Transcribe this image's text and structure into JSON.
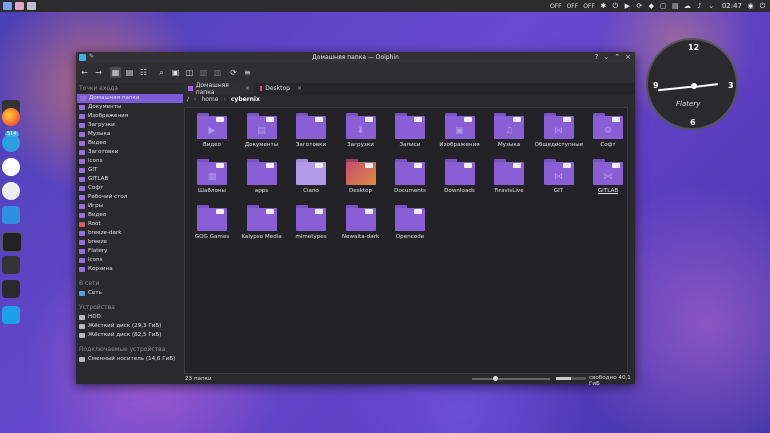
{
  "panel": {
    "off1": "OFF",
    "off2": "OFF",
    "off3": "OFF",
    "time": "02:47"
  },
  "clock": {
    "n12": "12",
    "n3": "3",
    "n6": "6",
    "n9": "9",
    "brand": "Flatery"
  },
  "window": {
    "title": "Домашняя папка — Dolphin",
    "controls": [
      "?",
      "⌄",
      "⌃",
      "×"
    ]
  },
  "sidebar": {
    "places_header": "Точки входа",
    "places": [
      "Домашняя папка",
      "Документы",
      "Изображения",
      "Загрузки",
      "Музыка",
      "Видео",
      "Заготовки",
      "icons",
      "GIT",
      "GITLAB",
      "Софт",
      "Рабочий стол",
      "Игры",
      "Видео",
      "Root",
      "breeze-dark",
      "breeze",
      "Flatery",
      "icons",
      "Корзина"
    ],
    "network_header": "В сети",
    "network": [
      "Сеть"
    ],
    "devices_header": "Устройства",
    "devices": [
      "HDD",
      "Жёсткий диск (29,3 ГиБ)",
      "Жёсткий диск (82,5 ГиБ)"
    ],
    "removable_header": "Подключаемые устройства",
    "removable": [
      "Сменный носитель (14,6 ГиБ)"
    ]
  },
  "tabs": [
    {
      "label": "Домашняя папка"
    },
    {
      "label": "Desktop"
    }
  ],
  "breadcrumb": {
    "root": "/",
    "home": "home",
    "user": "cybernix"
  },
  "folders": [
    {
      "name": "Видео",
      "glyph": "▶"
    },
    {
      "name": "Документы",
      "glyph": "▤"
    },
    {
      "name": "Заготовки",
      "glyph": ""
    },
    {
      "name": "Загрузки",
      "glyph": "⬇"
    },
    {
      "name": "Записи",
      "glyph": ""
    },
    {
      "name": "Изображения",
      "glyph": "▣"
    },
    {
      "name": "Музыка",
      "glyph": "♫"
    },
    {
      "name": "Общедоступные",
      "glyph": "⋈"
    },
    {
      "name": "Софт",
      "glyph": "⚙"
    },
    {
      "name": "Шаблоны",
      "glyph": "▦"
    },
    {
      "name": "apps",
      "glyph": ""
    },
    {
      "name": "Ciano",
      "glyph": ""
    },
    {
      "name": "Desktop",
      "glyph": ""
    },
    {
      "name": "Documents",
      "glyph": ""
    },
    {
      "name": "Downloads",
      "glyph": ""
    },
    {
      "name": "FiravisLive",
      "glyph": ""
    },
    {
      "name": "GIT",
      "glyph": "⋈"
    },
    {
      "name": "GITLAB",
      "glyph": "⋈"
    },
    {
      "name": "GOG Games",
      "glyph": ""
    },
    {
      "name": "Kalypso Media",
      "glyph": ""
    },
    {
      "name": "mimetypes",
      "glyph": ""
    },
    {
      "name": "Newaita-dark",
      "glyph": ""
    },
    {
      "name": "Opencode",
      "glyph": ""
    }
  ],
  "status": {
    "count": "23 папки",
    "free": "свободно 40,1 ГиБ",
    "zoom_fraction": 0.3,
    "used_fraction": 0.5
  },
  "dock_badge": "514",
  "colors": {
    "accent": "#7e5bd6",
    "folder": "#8a5fd6"
  }
}
